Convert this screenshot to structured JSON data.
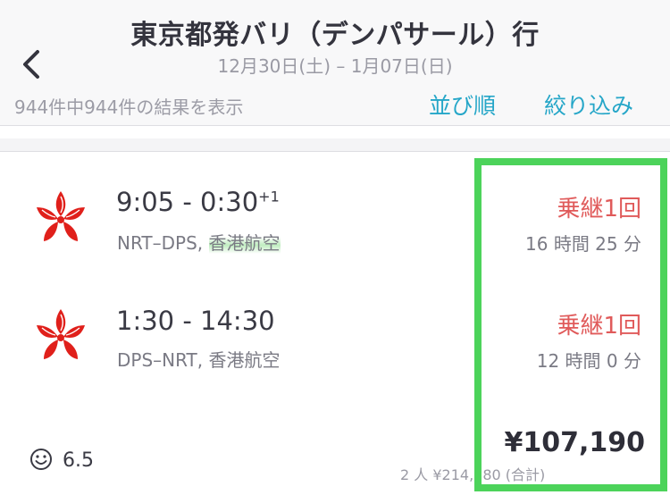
{
  "header": {
    "title": "東京都発バリ（デンパサール）行",
    "dates": "12月30日(土) – 1月07日(日)",
    "result_count": "944件中944件の結果を表示",
    "sort_label": "並び順",
    "filter_label": "絞り込み"
  },
  "result": {
    "legs": [
      {
        "time": "9:05 - 0:30",
        "day_offset": "+1",
        "route": "NRT–DPS,",
        "airline": "香港航空",
        "stops": "乗継1回",
        "duration": "16 時間 25 分"
      },
      {
        "time": "1:30 - 14:30",
        "route": "DPS–NRT,",
        "airline": "香港航空",
        "stops": "乗継1回",
        "duration": "12 時間 0 分"
      }
    ],
    "rating": "6.5",
    "price": "¥107,190",
    "price_sub": "2 人 ¥214,380 (合計)"
  },
  "colors": {
    "accent": "#25a6c8",
    "stops": "#e05a5a",
    "airline_logo": "#e0201b",
    "highlight": "#4cd35a"
  },
  "icons": {
    "back": "chevron-left-icon",
    "airline": "hong-kong-airlines-bauhinia-logo",
    "rating": "smiley-face-icon"
  }
}
